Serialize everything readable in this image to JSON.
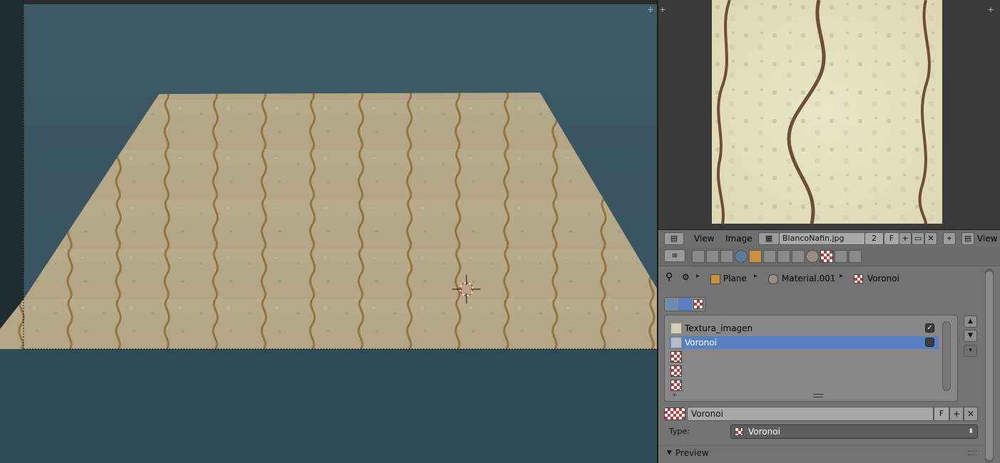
{
  "colors": {
    "accent_selected": "#5680c2",
    "viewport_bg": "#3d5a66",
    "panel_bg": "#737373"
  },
  "image_editor": {
    "menu_view": "View",
    "menu_image": "Image",
    "image_name": "BlancoNafin.jpg",
    "users": "2",
    "fake_user": "F",
    "view_label": "View",
    "icons": [
      "image-editor-icon",
      "browse-image-icon",
      "new-image-icon",
      "open-image-icon",
      "unlink-icon",
      "pin-icon"
    ]
  },
  "properties": {
    "tabs": [
      "render-icon",
      "render-layers-icon",
      "scene-icon",
      "world-icon",
      "object-icon",
      "constraints-icon",
      "modifiers-icon",
      "data-icon",
      "material-icon",
      "texture-icon",
      "particles-icon",
      "physics-icon"
    ],
    "breadcrumb": {
      "object": "Plane",
      "material": "Material.001",
      "texture": "Voronoi"
    },
    "texture_slots": [
      {
        "name": "Textura_imagen",
        "checked": true
      },
      {
        "name": "Voronoi",
        "checked": false,
        "selected": true
      },
      {
        "name": ""
      },
      {
        "name": ""
      },
      {
        "name": ""
      }
    ],
    "texture_datablock": {
      "name": "Voronoi",
      "fake_user": "F"
    },
    "type_label": "Type:",
    "type_value": "Voronoi",
    "preview_label": "Preview"
  }
}
